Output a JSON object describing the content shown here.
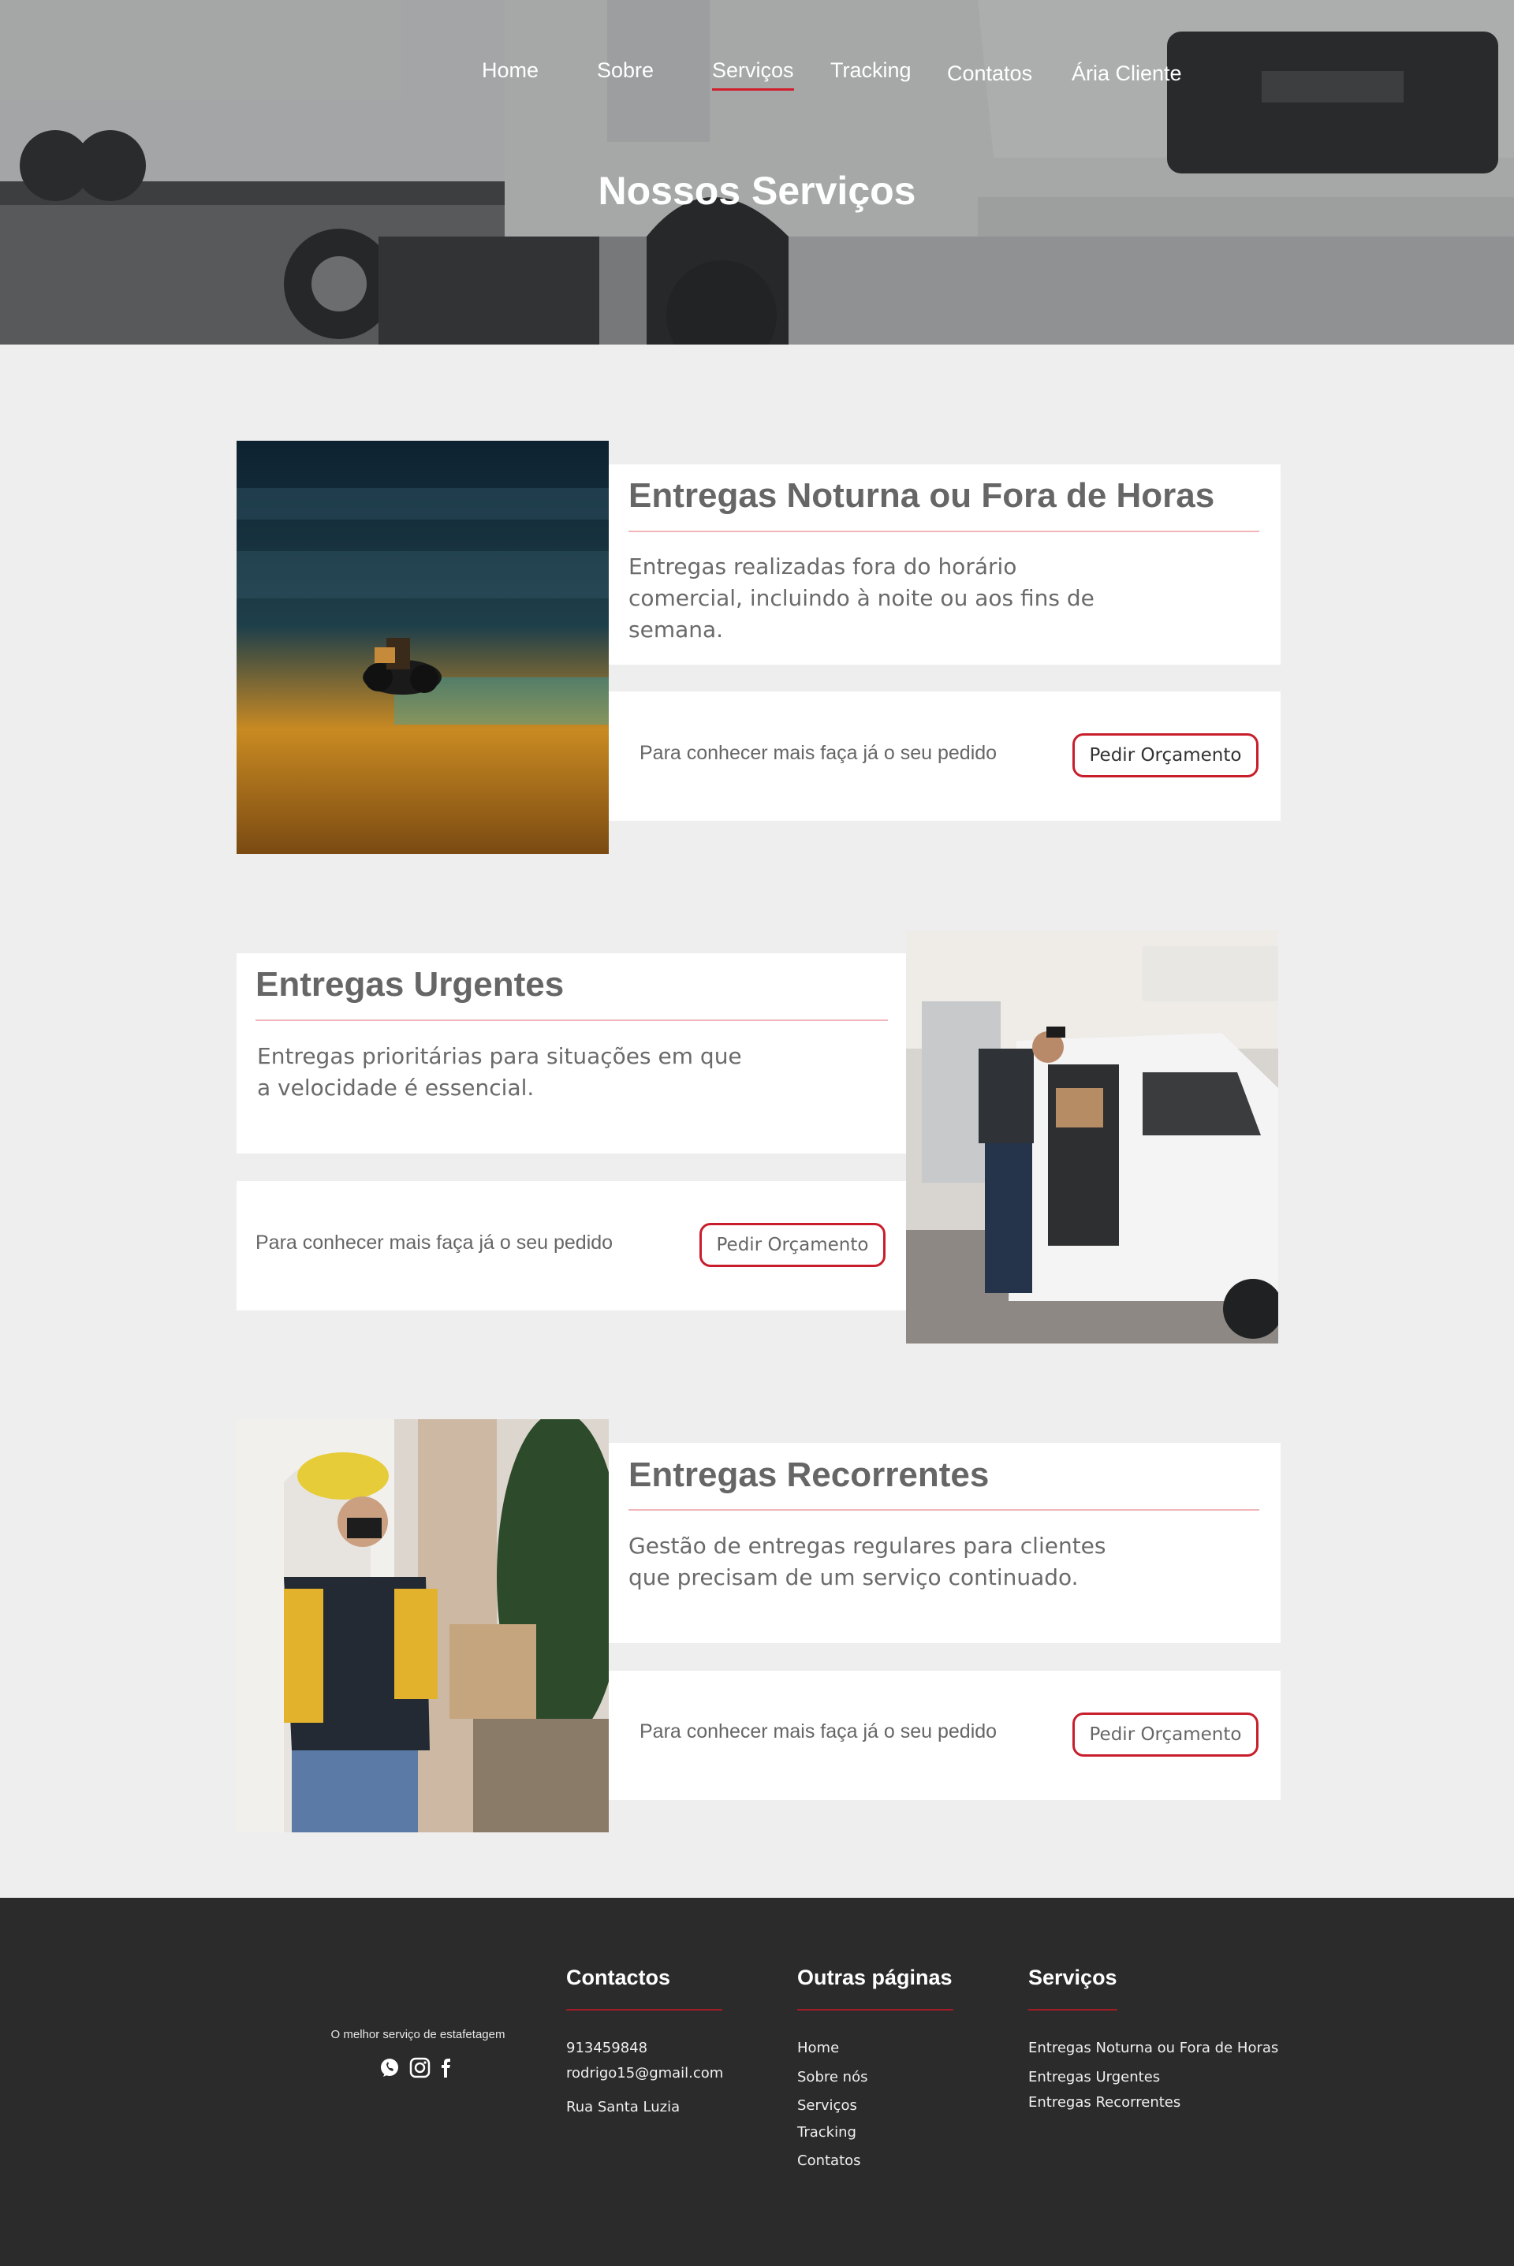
{
  "nav": {
    "items": [
      {
        "label": "Home"
      },
      {
        "label": "Sobre"
      },
      {
        "label": "Serviços"
      },
      {
        "label": "Tracking"
      },
      {
        "label": "Contatos"
      },
      {
        "label": "Ária Cliente"
      }
    ],
    "active": "Serviços"
  },
  "hero": {
    "title": "Nossos Serviços"
  },
  "services": [
    {
      "title": "Entregas Noturna ou Fora de Horas",
      "description": "Entregas realizadas fora do horário comercial, incluindo à noite ou aos fins de semana.",
      "cta_text": "Para conhecer mais faça já o seu pedido",
      "button": "Pedir Orçamento"
    },
    {
      "title": "Entregas Urgentes",
      "description": "Entregas prioritárias para situações em que a velocidade é essencial.",
      "cta_text": "Para conhecer mais faça já o seu pedido",
      "button": "Pedir Orçamento"
    },
    {
      "title": "Entregas Recorrentes",
      "description": "Gestão de entregas regulares para clientes que precisam de um serviço continuado.",
      "cta_text": "Para conhecer mais faça já o seu pedido",
      "button": "Pedir Orçamento"
    }
  ],
  "footer": {
    "tagline": "O melhor serviço de estafetagem",
    "social_icons": [
      "whatsapp-icon",
      "instagram-icon",
      "facebook-icon"
    ],
    "contacts": {
      "heading": "Contactos",
      "items": [
        "913459848",
        "rodrigo15@gmail.com",
        "Rua Santa Luzia"
      ]
    },
    "pages": {
      "heading": "Outras páginas",
      "items": [
        "Home",
        "Sobre nós",
        "Serviços",
        "Tracking",
        "Contatos"
      ]
    },
    "services": {
      "heading": "Serviços",
      "items": [
        "Entregas Noturna ou Fora de Horas",
        "Entregas Urgentes",
        "Entregas Recorrentes"
      ]
    }
  },
  "colors": {
    "accent": "#c81e2c",
    "background": "#eeeeee",
    "footer": "#2b2b2b",
    "heading_text": "#666666"
  }
}
